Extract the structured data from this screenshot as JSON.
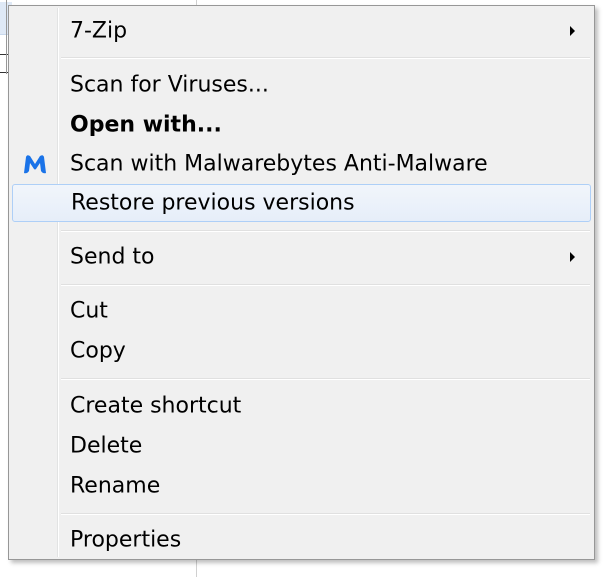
{
  "menu": {
    "items": [
      {
        "label": "7-Zip",
        "submenu": true
      },
      {
        "label": "Scan for Viruses..."
      },
      {
        "label": "Open with...",
        "bold": true
      },
      {
        "label": "Scan with Malwarebytes Anti-Malware",
        "icon": "malwarebytes-icon"
      },
      {
        "label": "Restore previous versions",
        "highlighted": true
      },
      {
        "label": "Send to",
        "submenu": true
      },
      {
        "label": "Cut"
      },
      {
        "label": "Copy"
      },
      {
        "label": "Create shortcut"
      },
      {
        "label": "Delete"
      },
      {
        "label": "Rename"
      },
      {
        "label": "Properties"
      }
    ]
  },
  "colors": {
    "menu_background": "#f0f0f0",
    "highlight_background": "#e6eef9",
    "highlight_border": "#aecff7",
    "malwarebytes_blue": "#1a73e8"
  }
}
